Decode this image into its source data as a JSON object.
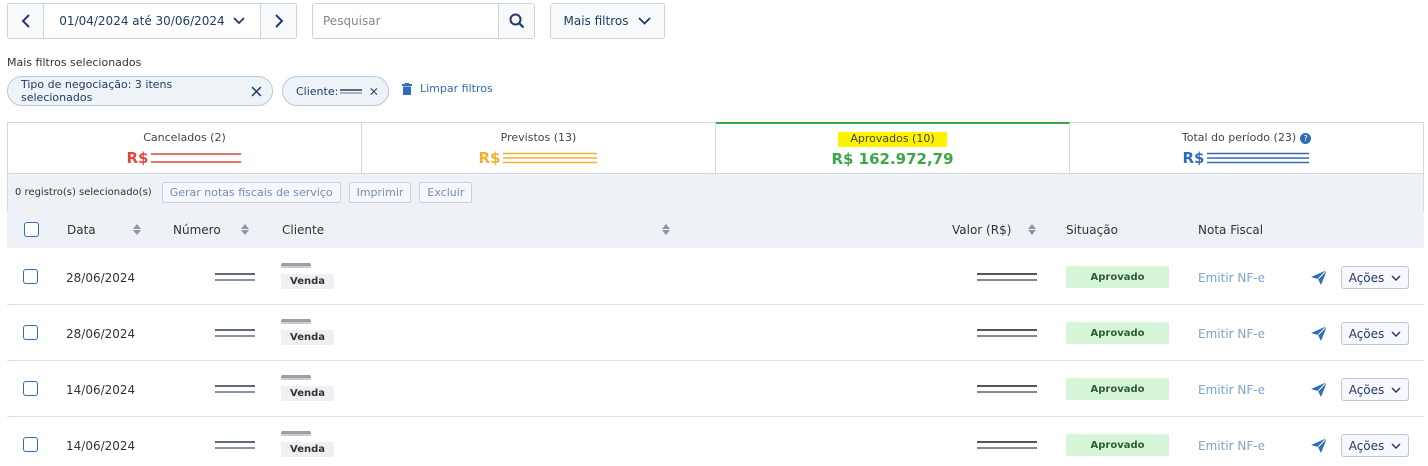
{
  "toolbar": {
    "date_range": "01/04/2024 até 30/06/2024",
    "search_placeholder": "Pesquisar",
    "more_filters_label": "Mais filtros"
  },
  "filters": {
    "selected_label": "Mais filtros selecionados",
    "chip_negotiation": "Tipo de negociação: 3 itens selecionados",
    "chip_client": "Cliente:",
    "clear_label": "Limpar filtros"
  },
  "summary": {
    "cancelados": {
      "title": "Cancelados (2)",
      "currency": "R$",
      "color": "#e0473e"
    },
    "previstos": {
      "title": "Previstos (13)",
      "currency": "R$",
      "color": "#f0b030"
    },
    "aprovados": {
      "title": "Aprovados (10)",
      "value": "R$ 162.972,79",
      "color": "#3ea64a"
    },
    "total": {
      "title": "Total do período (23)",
      "currency": "R$",
      "color": "#2f6db5",
      "help": "?"
    }
  },
  "bulk": {
    "count_label": "0 registro(s) selecionado(s)",
    "gerar_label": "Gerar notas fiscais de serviço",
    "imprimir_label": "Imprimir",
    "excluir_label": "Excluir"
  },
  "table": {
    "headers": {
      "data": "Data",
      "numero": "Número",
      "cliente": "Cliente",
      "valor": "Valor (R$)",
      "situacao": "Situação",
      "nota_fiscal": "Nota Fiscal"
    },
    "rows": [
      {
        "date": "28/06/2024",
        "type": "Venda",
        "status": "Aprovado",
        "nf": "Emitir NF-e",
        "actions": "Ações"
      },
      {
        "date": "28/06/2024",
        "type": "Venda",
        "status": "Aprovado",
        "nf": "Emitir NF-e",
        "actions": "Ações"
      },
      {
        "date": "14/06/2024",
        "type": "Venda",
        "status": "Aprovado",
        "nf": "Emitir NF-e",
        "actions": "Ações"
      },
      {
        "date": "14/06/2024",
        "type": "Venda",
        "status": "Aprovado",
        "nf": "Emitir NF-e",
        "actions": "Ações"
      }
    ]
  }
}
